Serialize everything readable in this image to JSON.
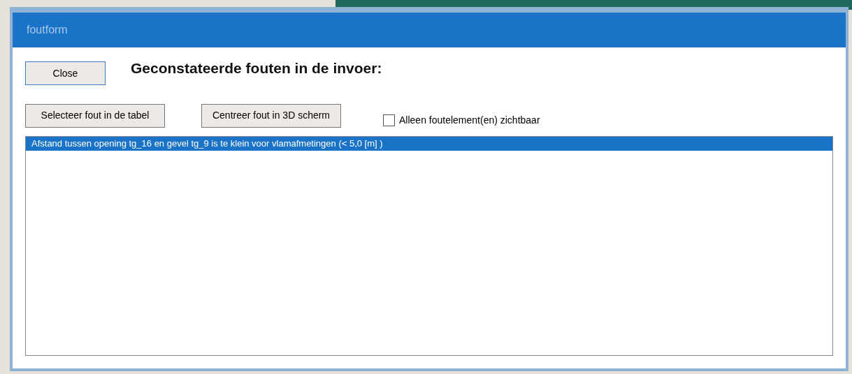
{
  "window": {
    "title": "foutform"
  },
  "close_button": "Close",
  "heading": "Geconstateerde fouten in de invoer:",
  "buttons": [
    "Selecteer fout in de tabel",
    "Centreer fout in 3D scherm"
  ],
  "checkbox": {
    "label": "Alleen foutelement(en) zichtbaar",
    "checked": false
  },
  "errors": [
    {
      "text": "Afstand tussen opening tg_16 en gevel tg_9 is te klein voor vlamafmetingen (<  5,0 [m] )",
      "selected": true
    }
  ]
}
